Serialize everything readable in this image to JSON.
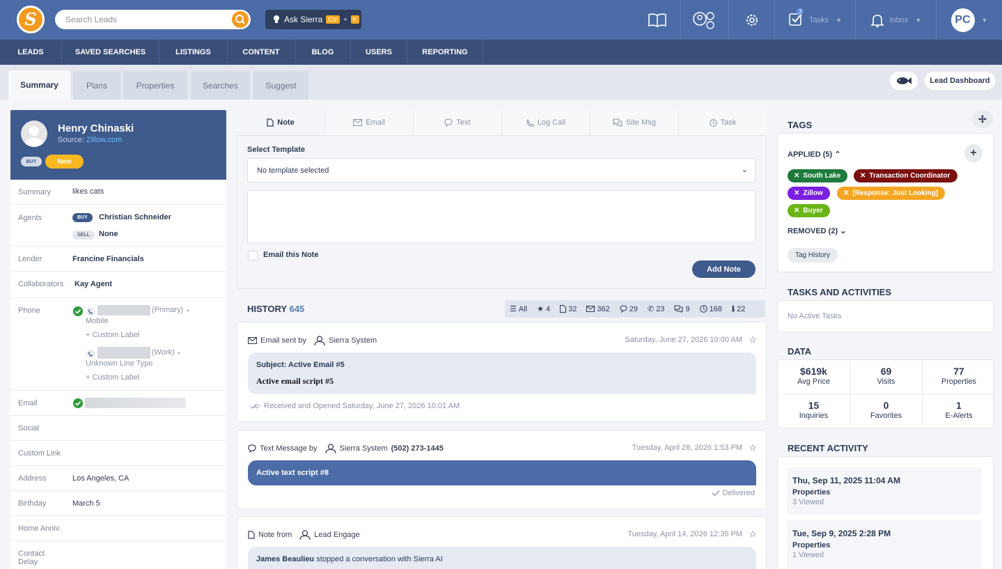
{
  "topbar": {
    "search_placeholder": "Search Leads",
    "ask_label": "Ask Sierra",
    "ask_key1": "Ctrl",
    "ask_plus": "+",
    "ask_key2": "K",
    "tasks_label": "Tasks",
    "tasks_count": "3",
    "inbox_label": "Inbox",
    "avatar_initials": "PC"
  },
  "nav": [
    "LEADS",
    "SAVED SEARCHES",
    "LISTINGS",
    "CONTENT",
    "BLOG",
    "USERS",
    "REPORTING"
  ],
  "tabs": [
    "Summary",
    "Plans",
    "Properties",
    "Searches",
    "Suggest"
  ],
  "lead_dashboard": "Lead Dashboard",
  "lead": {
    "name": "Henry Chinaski",
    "source_label": "Source:",
    "source": "Zillow.com",
    "buy_badge": "BUY",
    "status": "New"
  },
  "info": {
    "summary_label": "Summary",
    "summary": "likes cats",
    "agents_label": "Agents",
    "buy": "BUY",
    "buy_agent": "Christian Schneider",
    "sell": "SELL",
    "sell_agent": "None",
    "lender_label": "Lender",
    "lender": "Francine Financials",
    "collab_label": "Collaborators",
    "collab": "Kay Agent",
    "phone_label": "Phone",
    "phone1_type": "(Primary)",
    "phone1_line": "Mobile",
    "custom_label": "+ Custom Label",
    "phone2_type": "(Work)",
    "phone2_line": "Unknown Line Type",
    "email_label": "Email",
    "social_label": "Social",
    "custom_link_label": "Custom Link",
    "address_label": "Address",
    "address": "Los Angeles, CA",
    "birthday_label": "Birthday",
    "birthday": "March 5",
    "home_anniv_label": "Home Anniv.",
    "contact_delay_label": "Contact\nDelay"
  },
  "note_tabs": [
    "Note",
    "Email",
    "Text",
    "Log Call",
    "Site Msg",
    "Task"
  ],
  "note": {
    "template_label": "Select Template",
    "template_value": "No template selected",
    "email_note_label": "Email this Note",
    "add_button": "Add Note"
  },
  "history": {
    "title": "HISTORY",
    "count": "645",
    "filters": [
      {
        "icon": "list-icon",
        "label": "All"
      },
      {
        "icon": "star-icon",
        "label": "4"
      },
      {
        "icon": "note-icon",
        "label": "32"
      },
      {
        "icon": "email-icon",
        "label": "362"
      },
      {
        "icon": "text-icon",
        "label": "29"
      },
      {
        "icon": "phone-icon",
        "label": "23"
      },
      {
        "icon": "site-msg-icon",
        "label": "9"
      },
      {
        "icon": "task-icon",
        "label": "168"
      },
      {
        "icon": "info-icon",
        "label": "22"
      }
    ],
    "items": [
      {
        "type_label": "Email sent by",
        "author": "Sierra System",
        "date": "Saturday, June 27, 2026 10:00 AM",
        "subject": "Subject: Active Email #5",
        "body": "Active email script #5",
        "footer": "Received and Opened Saturday, June 27, 2026 10:01 AM"
      },
      {
        "type_label": "Text Message by",
        "author": "Sierra System",
        "phone": "(502) 273-1445",
        "date": "Tuesday, April 28, 2026 1:53 PM",
        "body": "Active text script #8",
        "footer": "Delivered"
      },
      {
        "type_label": "Note from",
        "author": "Lead Engage",
        "date": "Tuesday, April 14, 2026 12:35 PM",
        "body_name": "James Beaulieu",
        "body": "stopped a conversation with Sierra AI"
      }
    ]
  },
  "tags": {
    "title": "TAGS",
    "applied_label": "APPLIED (5)",
    "items": [
      {
        "label": "South Lake",
        "color": "#1e7a3c"
      },
      {
        "label": "Transaction Coordinator",
        "color": "#7a1010"
      },
      {
        "label": "Zillow",
        "color": "#7b1fe0"
      },
      {
        "label": "[Response: Just Looking]",
        "color": "#f5a623"
      },
      {
        "label": "Buyer",
        "color": "#6ab516"
      }
    ],
    "removed_label": "REMOVED (2)",
    "history_button": "Tag History"
  },
  "tasks": {
    "title": "TASKS AND ACTIVITIES",
    "empty": "No Active Tasks"
  },
  "data_section": {
    "title": "DATA",
    "cells": [
      {
        "value": "$619k",
        "label": "Avg Price"
      },
      {
        "value": "69",
        "label": "Visits"
      },
      {
        "value": "77",
        "label": "Properties"
      },
      {
        "value": "15",
        "label": "Inquiries"
      },
      {
        "value": "0",
        "label": "Favorites"
      },
      {
        "value": "1",
        "label": "E-Alerts"
      }
    ]
  },
  "recent": {
    "title": "RECENT ACTIVITY",
    "items": [
      {
        "date": "Thu, Sep 11, 2025 11:04 AM",
        "type": "Properties",
        "detail": "3 Viewed"
      },
      {
        "date": "Tue, Sep 9, 2025 2:28 PM",
        "type": "Properties",
        "detail": "1 Viewed"
      }
    ]
  }
}
